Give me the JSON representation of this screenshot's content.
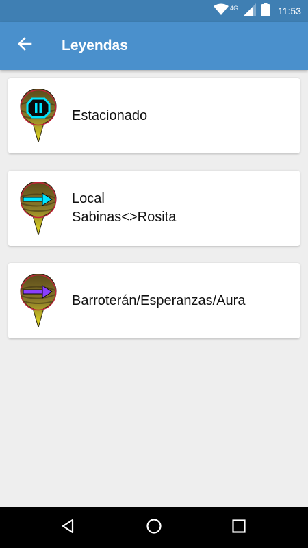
{
  "status_bar": {
    "time": "11:53",
    "network_label": "4G",
    "icons": [
      "wifi-icon",
      "signal-icon",
      "battery-icon"
    ]
  },
  "app_bar": {
    "title": "Leyendas",
    "back_icon": "arrow-back-icon",
    "color": "#4a90cc"
  },
  "legends": [
    {
      "lines": [
        "Estacionado"
      ],
      "icon": "pause-pin-icon",
      "symbol_color": "#00e5ff"
    },
    {
      "lines": [
        "Local",
        "Sabinas<>Rosita"
      ],
      "icon": "arrow-right-pin-icon",
      "symbol_color": "#00e5ff"
    },
    {
      "lines": [
        "Barroterán/Esperanzas/Aura"
      ],
      "icon": "arrow-right-pin-icon",
      "symbol_color": "#8a3ffc"
    }
  ],
  "nav_bar": {
    "buttons": [
      "back-triangle-icon",
      "home-circle-icon",
      "recents-square-icon"
    ]
  }
}
